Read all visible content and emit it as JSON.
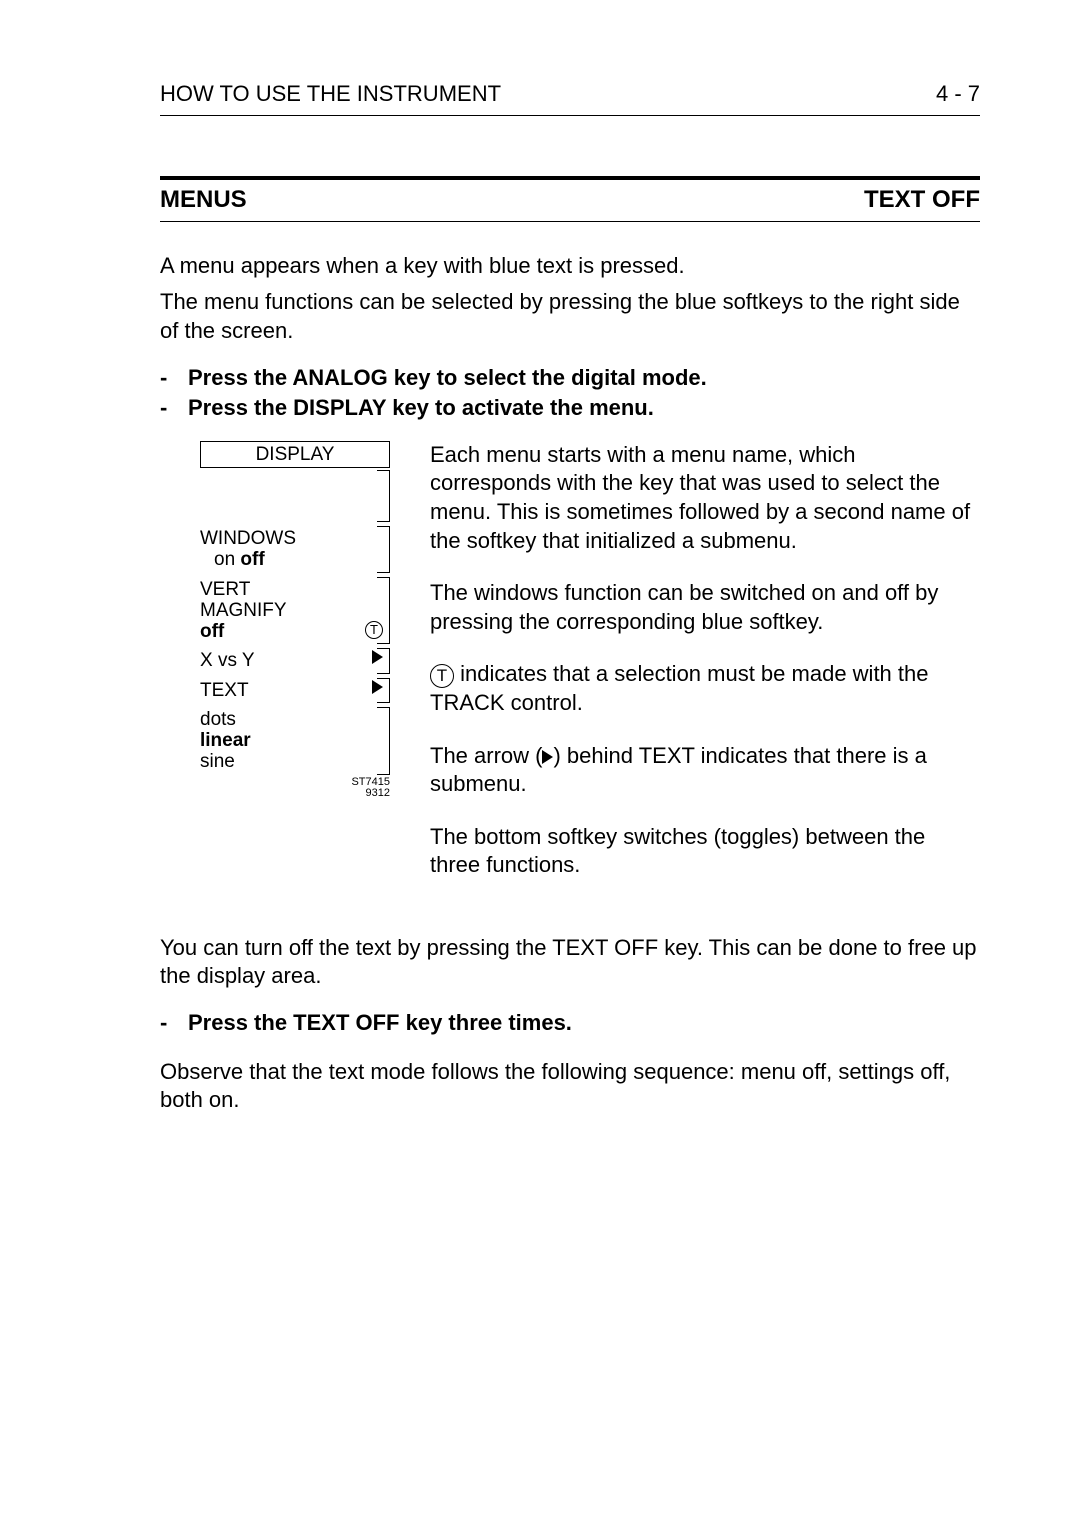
{
  "header": {
    "left": "HOW TO USE THE INSTRUMENT",
    "right": "4 - 7"
  },
  "section": {
    "left": "MENUS",
    "right": "TEXT OFF"
  },
  "intro1": "A menu appears when a key with blue text is pressed.",
  "intro2": "The menu functions can be selected by pressing the blue softkeys to the right side of the screen.",
  "bullets1": {
    "dash": "-",
    "a": "Press the ANALOG key to select the digital mode.",
    "b": "Press the DISPLAY key to activate the menu."
  },
  "diagram": {
    "title": "DISPLAY",
    "windows": "WINDOWS",
    "on": "on ",
    "off": "off",
    "vert": "VERT",
    "magnify": "MAGNIFY",
    "off2": "off",
    "xvsy": "X vs Y",
    "text": "TEXT",
    "dots": "dots",
    "linear": "linear",
    "sine": "sine",
    "ref1": "ST7415",
    "ref2": "9312",
    "tchar": "T"
  },
  "desc": {
    "p1": "Each menu starts with a menu name, which corresponds with the key that was used to select the menu. This is sometimes followed by a second name of the softkey that initialized a submenu.",
    "p2": "The windows function can be switched on and off by pressing the corresponding blue softkey.",
    "p3a": " indicates that a selection must be made with the TRACK control.",
    "p4a": "The arrow (",
    "p4b": ") behind TEXT indicates that there is a submenu.",
    "p5": "The bottom softkey switches (toggles) between the three functions."
  },
  "after1": "You can turn off the text by pressing the TEXT OFF key. This can be done to free up the display area.",
  "bullets2": {
    "a": "Press the TEXT OFF key three times."
  },
  "after2": "Observe that the text mode follows the following sequence: menu off, settings off, both on."
}
